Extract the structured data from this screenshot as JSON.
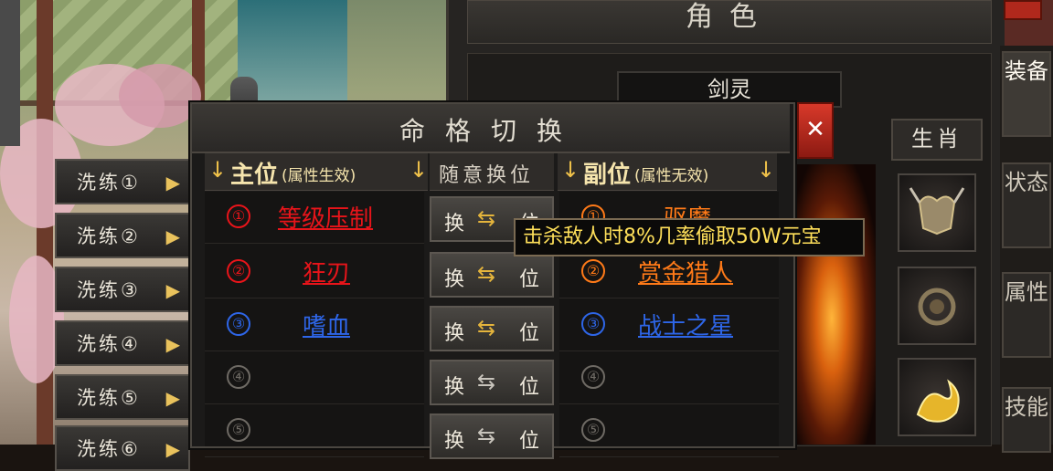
{
  "character_window": {
    "title": "角色",
    "name": "剑灵",
    "close_label": "✕",
    "zodiac_label": "生肖",
    "side_tabs": [
      "装备",
      "状态",
      "属性",
      "技能"
    ]
  },
  "wash_buttons": [
    "洗练①",
    "洗练②",
    "洗练③",
    "洗练④",
    "洗练⑤",
    "洗练⑥"
  ],
  "dialog": {
    "title": "命格切换",
    "primary_header": "主位",
    "primary_note": "(属性生效)",
    "middle_header": "随意换位",
    "secondary_header": "副位",
    "secondary_note": "(属性无效)",
    "swap_left": "换",
    "swap_right": "位",
    "primary_slots": [
      {
        "num": "①",
        "name": "等级压制",
        "color": "#e8141a"
      },
      {
        "num": "②",
        "name": "狂刃",
        "color": "#e8141a"
      },
      {
        "num": "③",
        "name": "嗜血",
        "color": "#2e66e8"
      },
      {
        "num": "④",
        "name": "",
        "color": "#6e6a64"
      },
      {
        "num": "⑤",
        "name": "",
        "color": "#6e6a64"
      }
    ],
    "secondary_slots": [
      {
        "num": "①",
        "name": "驱魔",
        "color": "#ff7a18"
      },
      {
        "num": "②",
        "name": "赏金猎人",
        "color": "#ff7a18"
      },
      {
        "num": "③",
        "name": "战士之星",
        "color": "#2e66e8"
      },
      {
        "num": "④",
        "name": "",
        "color": "#6e6a64"
      },
      {
        "num": "⑤",
        "name": "",
        "color": "#6e6a64"
      }
    ]
  },
  "tooltip": "击杀敌人时8%几率偷取50W元宝",
  "colors": {
    "accent_gold": "#e4b43c",
    "tooltip_text": "#ffe05a",
    "red": "#e8141a",
    "blue": "#2e66e8",
    "orange": "#ff7a18"
  }
}
